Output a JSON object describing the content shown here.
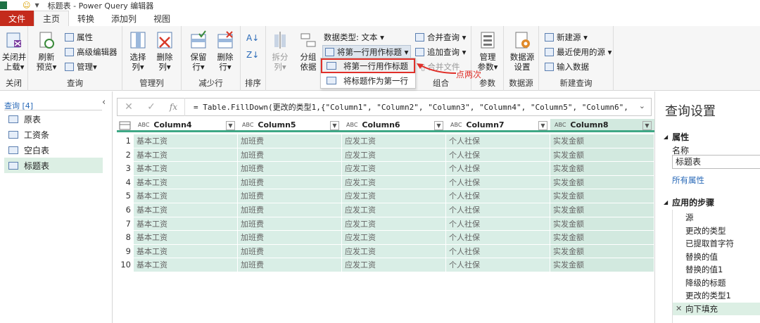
{
  "window": {
    "title": "标题表 - Power Query 编辑器"
  },
  "tabs": [
    "文件",
    "主页",
    "转换",
    "添加列",
    "视图"
  ],
  "ribbon": {
    "close": {
      "label1": "关闭并",
      "label2": "上载▾",
      "group": "关闭"
    },
    "query": {
      "refresh1": "刷新",
      "refresh2": "预览▾",
      "properties": "属性",
      "advanced_editor": "高级编辑器",
      "manage": "管理▾",
      "group": "查询"
    },
    "manage_columns": {
      "choose1": "选择",
      "choose2": "列▾",
      "remove1": "删除",
      "remove2": "列▾",
      "group": "管理列"
    },
    "reduce_rows": {
      "keep1": "保留",
      "keep2": "行▾",
      "remove1": "删除",
      "remove2": "行▾",
      "group": "减少行"
    },
    "sort": {
      "group": "排序"
    },
    "transform": {
      "split1": "拆分",
      "split2": "列▾",
      "groupby1": "分组",
      "groupby2": "依据",
      "datatype": "数据类型: 文本 ▾",
      "use_first_row": "将第一行用作标题 ▾"
    },
    "combine": {
      "merge": "合并查询 ▾",
      "append": "追加查询 ▾",
      "combine_files": "合并文件",
      "group": "组合"
    },
    "params": {
      "manage1": "管理",
      "manage2": "参数▾",
      "group": "参数"
    },
    "datasource": {
      "label1": "数据源",
      "label2": "设置",
      "group": "数据源"
    },
    "new_query": {
      "new_source": "新建源 ▾",
      "recent": "最近使用的源 ▾",
      "enter_data": "输入数据",
      "group": "新建查询"
    }
  },
  "popup": {
    "item1": "将第一行用作标题",
    "item2": "将标题作为第一行"
  },
  "annotation": "点两次",
  "left_panel": {
    "title": "查询 [4]",
    "items": [
      "原表",
      "工资条",
      "空白表",
      "标题表"
    ]
  },
  "formula": "= Table.FillDown(更改的类型1,{\"Column1\", \"Column2\", \"Column3\", \"Column4\", \"Column5\", \"Column6\",",
  "grid": {
    "columns": [
      "Column4",
      "Column5",
      "Column6",
      "Column7",
      "Column8"
    ],
    "row_values": [
      "基本工资",
      "加班费",
      "应发工资",
      "个人社保",
      "实发金额"
    ],
    "row_count": 10
  },
  "right_panel": {
    "title": "查询设置",
    "properties": "属性",
    "name_label": "名称",
    "name_value": "标题表",
    "all_properties": "所有属性",
    "applied_steps": "应用的步骤",
    "steps": [
      "源",
      "更改的类型",
      "已提取首字符",
      "替换的值",
      "替换的值1",
      "降级的标题",
      "更改的类型1",
      "向下填充"
    ]
  }
}
